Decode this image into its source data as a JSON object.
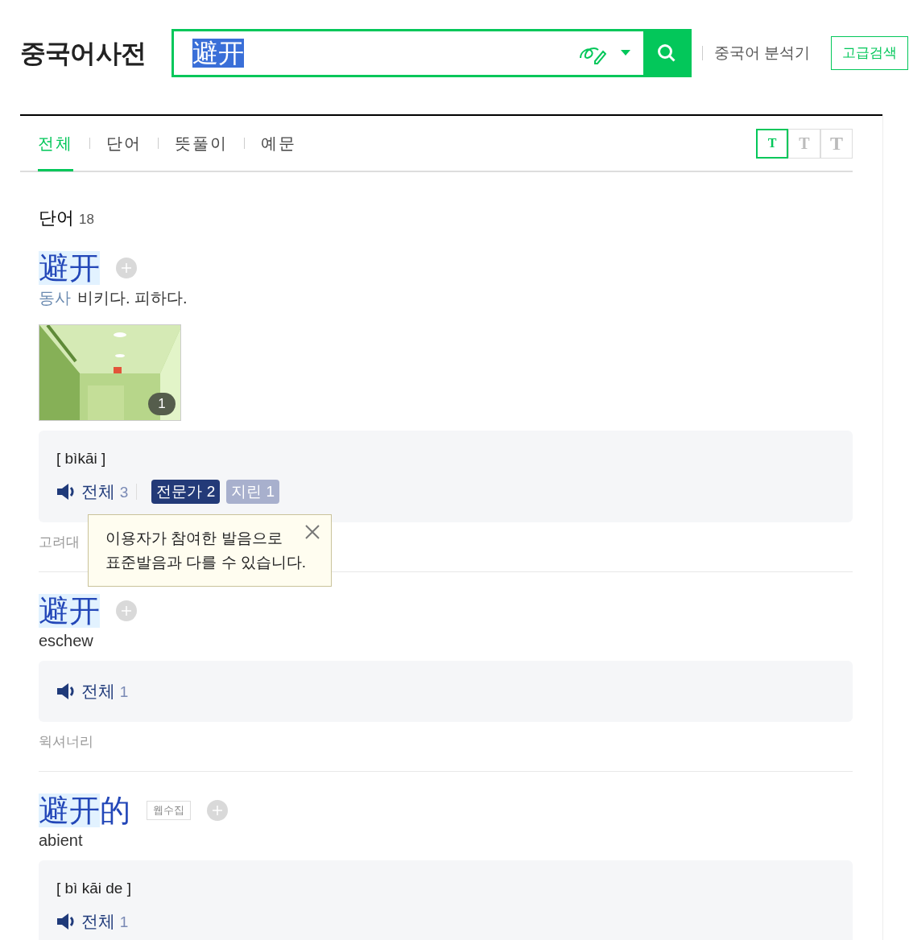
{
  "header": {
    "logo": "중국어사전",
    "search": {
      "value": "避开",
      "selected": true
    },
    "analyzer_link": "중국어 분석기",
    "advanced_button": "고급검색"
  },
  "tabs": [
    {
      "label": "전체",
      "selected": true
    },
    {
      "label": "단어",
      "selected": false
    },
    {
      "label": "뜻풀이",
      "selected": false
    },
    {
      "label": "예문",
      "selected": false
    }
  ],
  "font_sizes": [
    {
      "label": "T",
      "selected": true
    },
    {
      "label": "T",
      "selected": false
    },
    {
      "label": "T",
      "selected": false
    }
  ],
  "section": {
    "title": "단어",
    "count": "18"
  },
  "entries": [
    {
      "headword_match": "避开",
      "meaning_pos": "동사",
      "meaning": "비키다. 피하다.",
      "image": {
        "kind": "picture",
        "count": "1"
      },
      "pinyin": "[ bìkāi ]",
      "audio_label": "전체",
      "audio_count": "3",
      "badges": [
        {
          "label": "전문가",
          "count": "2",
          "kind": "expert"
        },
        {
          "label": "지린",
          "count": "1",
          "kind": "region"
        }
      ],
      "source": "고려대",
      "tooltip": {
        "lines": [
          "이용자가 참여한 발음으로",
          "표준발음과 다를 수 있습니다."
        ]
      }
    },
    {
      "headword_match": "避开",
      "meaning": "eschew",
      "audio_label": "전체",
      "audio_count": "1",
      "source": "윅셔너리"
    },
    {
      "headword_match": "避开",
      "headword_rest": "的",
      "web_tag": "웹수집",
      "meaning": "abient",
      "pinyin": "[ bì kāi de ]",
      "audio_label": "전체",
      "audio_count": "1"
    }
  ]
}
